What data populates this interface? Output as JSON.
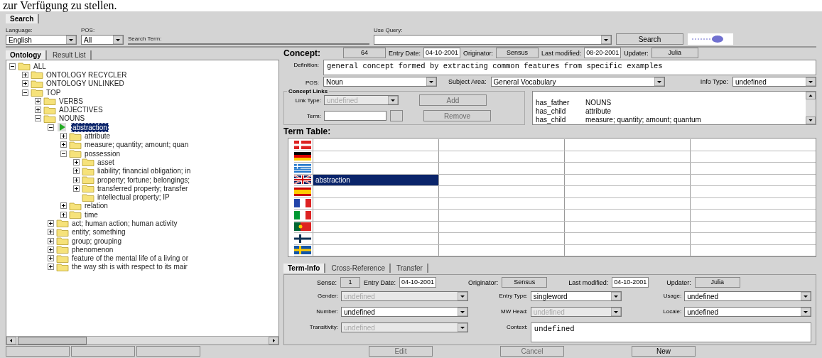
{
  "document_text": "zur Verfügung zu stellen.",
  "top_tabs": [
    {
      "label": "Search",
      "selected": true
    }
  ],
  "search": {
    "language_label": "Language:",
    "language": "English",
    "pos_label": "POS:",
    "pos": "All",
    "term_label": "Search Term:",
    "query_label": "Use Query:",
    "search_button": "Search"
  },
  "left_tabs": [
    {
      "label": "Ontology",
      "selected": true
    },
    {
      "label": "Result List",
      "selected": false
    }
  ],
  "tree": [
    {
      "label": "ALL",
      "kind": "folder",
      "expanded": true,
      "selected": false,
      "children": [
        {
          "label": "ONTOLOGY RECYCLER",
          "kind": "folder",
          "expanded": false,
          "selected": false
        },
        {
          "label": "ONTOLOGY UNLINKED",
          "kind": "folder",
          "expanded": false,
          "selected": false
        },
        {
          "label": "TOP",
          "kind": "folder",
          "expanded": true,
          "selected": false,
          "children": [
            {
              "label": "VERBS",
              "kind": "folder",
              "expanded": false,
              "selected": false
            },
            {
              "label": "ADJECTIVES",
              "kind": "folder",
              "expanded": false,
              "selected": false
            },
            {
              "label": "NOUNS",
              "kind": "folder",
              "expanded": true,
              "selected": false,
              "children": [
                {
                  "label": "abstraction",
                  "kind": "current",
                  "expanded": true,
                  "selected": true,
                  "children": [
                    {
                      "label": "attribute",
                      "kind": "folder",
                      "expanded": false,
                      "selected": false
                    },
                    {
                      "label": "measure; quantity; amount; quan",
                      "kind": "folder",
                      "expanded": false,
                      "selected": false
                    },
                    {
                      "label": "possession",
                      "kind": "folder",
                      "expanded": true,
                      "selected": false,
                      "children": [
                        {
                          "label": "asset",
                          "kind": "folder",
                          "expanded": false,
                          "selected": false
                        },
                        {
                          "label": "liability; financial obligation; in",
                          "kind": "folder",
                          "expanded": false,
                          "selected": false
                        },
                        {
                          "label": "property; fortune; belongings;",
                          "kind": "folder",
                          "expanded": false,
                          "selected": false
                        },
                        {
                          "label": "transferred property; transfer",
                          "kind": "folder",
                          "expanded": false,
                          "selected": false
                        },
                        {
                          "label": "intellectual property; IP",
                          "kind": "leaf",
                          "selected": false
                        }
                      ]
                    },
                    {
                      "label": "relation",
                      "kind": "folder",
                      "expanded": false,
                      "selected": false
                    },
                    {
                      "label": "time",
                      "kind": "folder",
                      "expanded": false,
                      "selected": false
                    }
                  ]
                },
                {
                  "label": "act; human action; human activity",
                  "kind": "folder",
                  "expanded": false,
                  "selected": false
                },
                {
                  "label": "entity; something",
                  "kind": "folder",
                  "expanded": false,
                  "selected": false
                },
                {
                  "label": "group; grouping",
                  "kind": "folder",
                  "expanded": false,
                  "selected": false
                },
                {
                  "label": "phenomenon",
                  "kind": "folder",
                  "expanded": false,
                  "selected": false
                },
                {
                  "label": "feature of the mental life of a living or",
                  "kind": "folder",
                  "expanded": false,
                  "selected": false
                },
                {
                  "label": "the way sth is with respect to its mair",
                  "kind": "folder",
                  "expanded": false,
                  "selected": false
                }
              ]
            }
          ]
        }
      ]
    }
  ],
  "concept": {
    "label": "Concept:",
    "id": "64",
    "entry_date_label": "Entry Date:",
    "entry_date": "04-10-2001",
    "originator_label": "Originator:",
    "originator": "Sensus",
    "modified_label": "Last modified:",
    "modified": "08-20-2001",
    "updater_label": "Updater:",
    "updater": "Julia",
    "definition_label": "Definition:",
    "definition": "general concept formed by extracting common features from specific examples",
    "pos_label": "POS:",
    "pos": "Noun",
    "subject_label": "Subject Area:",
    "subject": "General Vocabulary",
    "info_label": "Info Type:",
    "info": "undefined"
  },
  "concept_links": {
    "title": "Concept Links",
    "link_type_label": "Link Type:",
    "link_type": "undefined",
    "link_type_disabled": true,
    "term_label": "Term:",
    "add_button": {
      "label": "Add",
      "disabled": true
    },
    "remove_button": {
      "label": "Remove",
      "disabled": true
    },
    "links": [
      {
        "relation": "has_father",
        "target": "NOUNS"
      },
      {
        "relation": "has_child",
        "target": "attribute"
      },
      {
        "relation": "has_child",
        "target": "measure; quantity; amount; quantum"
      }
    ]
  },
  "term_table": {
    "title": "Term Table:",
    "rows": [
      {
        "kind": "da",
        "selected": false
      },
      {
        "kind": "de",
        "selected": false
      },
      {
        "kind": "el",
        "selected": false
      },
      {
        "kind": "en",
        "term": "abstraction",
        "selected": true
      },
      {
        "kind": "es",
        "selected": false
      },
      {
        "kind": "fr",
        "selected": false
      },
      {
        "kind": "it",
        "selected": false
      },
      {
        "kind": "pt",
        "selected": false
      },
      {
        "kind": "fi",
        "selected": false
      },
      {
        "kind": "sv",
        "selected": false
      }
    ]
  },
  "detail_tabs": [
    {
      "label": "Term-Info",
      "selected": true
    },
    {
      "label": "Cross-Reference",
      "selected": false
    },
    {
      "label": "Transfer",
      "selected": false
    }
  ],
  "term_info": {
    "header": [
      {
        "label": "Sense:",
        "value": "1",
        "kind": "readonly"
      },
      {
        "label": "Entry Date:",
        "value": "04-10-2001",
        "kind": "text"
      },
      {
        "label": "Originator:",
        "value": "Sensus",
        "kind": "readonly"
      },
      {
        "label": "Last modified:",
        "value": "04-10-2001",
        "kind": "text"
      },
      {
        "label": "Updater:",
        "value": "Julia",
        "kind": "readonly"
      }
    ],
    "fields": [
      {
        "label": "Gender:",
        "value": "undefined",
        "kind": "select",
        "disabled": true
      },
      {
        "label": "Entry Type:",
        "value": "singleword",
        "kind": "select",
        "disabled": false
      },
      {
        "label": "Usage:",
        "value": "undefined",
        "kind": "select",
        "disabled": false
      },
      {
        "label": "Number:",
        "value": "undefined",
        "kind": "select",
        "disabled": false
      },
      {
        "label": "MW Head:",
        "value": "undefined",
        "kind": "select",
        "disabled": true
      },
      {
        "label": "Locale:",
        "value": "undefined",
        "kind": "select",
        "disabled": false
      },
      {
        "label": "Transitivity:",
        "value": "undefined",
        "kind": "select",
        "disabled": true
      },
      {
        "label": "Context:",
        "value": "undefined",
        "kind": "area",
        "disabled": false
      }
    ]
  },
  "bottom_buttons": [
    {
      "label": "Edit",
      "disabled": true
    },
    {
      "label": "Cancel",
      "disabled": true
    },
    {
      "label": "New",
      "disabled": false
    }
  ]
}
